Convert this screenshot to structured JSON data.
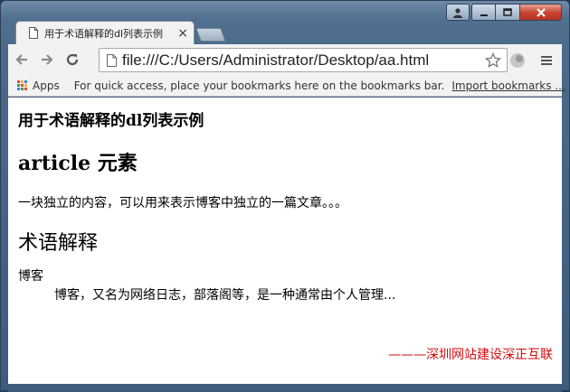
{
  "tab": {
    "title": "用于术语解释的dl列表示例",
    "close_label": "×"
  },
  "address_bar": {
    "url": "file:///C:/Users/Administrator/Desktop/aa.html"
  },
  "bookmarks": {
    "apps_label": "Apps",
    "hint": "For quick access, place your bookmarks here on the bookmarks bar.",
    "import_label": "Import bookmarks ..."
  },
  "page": {
    "title": "用于术语解释的dl列表示例",
    "article_heading": "article 元素",
    "article_text": "一块独立的内容，可以用来表示博客中独立的一篇文章。。。",
    "glossary_heading": "术语解释",
    "term": "博客",
    "definition": "博客，又名为网络日志，部落阁等，是一种通常由个人管理...",
    "footer": "———深圳网站建设深正互联"
  },
  "icons": [
    "user-icon",
    "minimize-icon",
    "maximize-icon",
    "close-icon",
    "page-icon",
    "back-icon",
    "forward-icon",
    "reload-icon",
    "star-icon",
    "extension-icon",
    "menu-icon",
    "apps-icon"
  ],
  "colors": {
    "footer_text": "#d30a0a",
    "close_button": "#c8422f"
  }
}
